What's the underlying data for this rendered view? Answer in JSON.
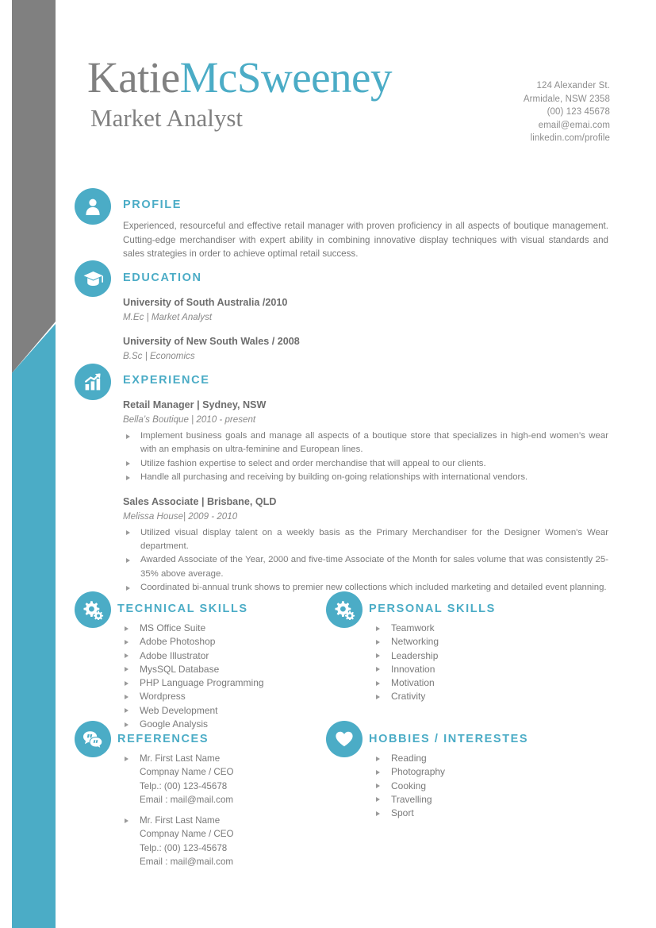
{
  "header": {
    "name_first": "Katie",
    "name_last": "McSweeney",
    "job_title": "Market Analyst",
    "contact": {
      "street": "124 Alexander St.",
      "city": "Armidale, NSW 2358",
      "phone": "(00) 123 45678",
      "email": "email@emai.com",
      "linkedin": "linkedin.com/profile"
    }
  },
  "colors": {
    "accent": "#4bacc6",
    "gray_stripe": "#808080",
    "body_text": "#7a7a7a",
    "heading_gray": "#6d6d6d"
  },
  "profile": {
    "heading": "PROFILE",
    "icon": "person-icon",
    "text": "Experienced, resourceful and effective retail manager with proven proficiency in all aspects of boutique management. Cutting-edge merchandiser with expert ability in combining innovative display techniques with visual standards and sales strategies in order to achieve optimal retail success."
  },
  "education": {
    "heading": "EDUCATION",
    "icon": "graduation-cap-icon",
    "entries": [
      {
        "school": "University of South Australia /2010",
        "degree": "M.Ec  | Market  Analyst"
      },
      {
        "school": "University of New South Wales / 2008",
        "degree": "B.Sc | Economics"
      }
    ]
  },
  "experience": {
    "heading": "EXPERIENCE",
    "icon": "growth-chart-icon",
    "jobs": [
      {
        "title": "Retail Manager | Sydney, NSW",
        "company": "Bella’s Boutique | 2010 - present",
        "bullets": [
          "Implement business goals and manage all aspects of a boutique store that specializes in high-end women’s wear with an emphasis on ultra-feminine and European lines.",
          "Utilize fashion expertise to select and order merchandise that will appeal to our clients.",
          "Handle all purchasing and receiving by building on-going relationships with international vendors."
        ]
      },
      {
        "title": "Sales Associate | Brisbane, QLD",
        "company": "Melissa House| 2009 - 2010",
        "bullets": [
          "Utilized visual display talent on a weekly basis as the Primary Merchandiser for the Designer Women's Wear department.",
          "Awarded Associate of the Year, 2000 and five-time Associate of the Month for sales volume that was consistently 25-35% above average.",
          "Coordinated bi-annual trunk shows to premier new collections which included marketing and detailed event planning."
        ]
      }
    ]
  },
  "technical_skills": {
    "heading": "TECHNICAL  SKILLS",
    "icon": "gears-icon",
    "items": [
      "MS Office Suite",
      "Adobe Photoshop",
      "Adobe Illustrator",
      "MysSQL Database",
      "PHP Language Programming",
      "Wordpress",
      "Web Development",
      "Google Analysis"
    ]
  },
  "personal_skills": {
    "heading": "PERSONAL SKILLS",
    "icon": "gears-icon",
    "items": [
      "Teamwork",
      "Networking",
      "Leadership",
      "Innovation",
      "Motivation",
      "Crativity"
    ]
  },
  "references": {
    "heading": "REFERENCES",
    "icon": "speech-bubbles-icon",
    "entries": [
      {
        "name": "Mr. First Last Name",
        "company": "Compnay Name / CEO",
        "phone": "Telp.: (00) 123-45678",
        "email": "Email : mail@mail.com"
      },
      {
        "name": "Mr. First Last Name",
        "company": "Compnay Name / CEO",
        "phone": "Telp.: (00) 123-45678",
        "email": "Email : mail@mail.com"
      }
    ]
  },
  "hobbies": {
    "heading": "HOBBIES / INTERESTES",
    "icon": "heart-icon",
    "items": [
      "Reading",
      "Photography",
      "Cooking",
      "Travelling",
      "Sport"
    ]
  }
}
